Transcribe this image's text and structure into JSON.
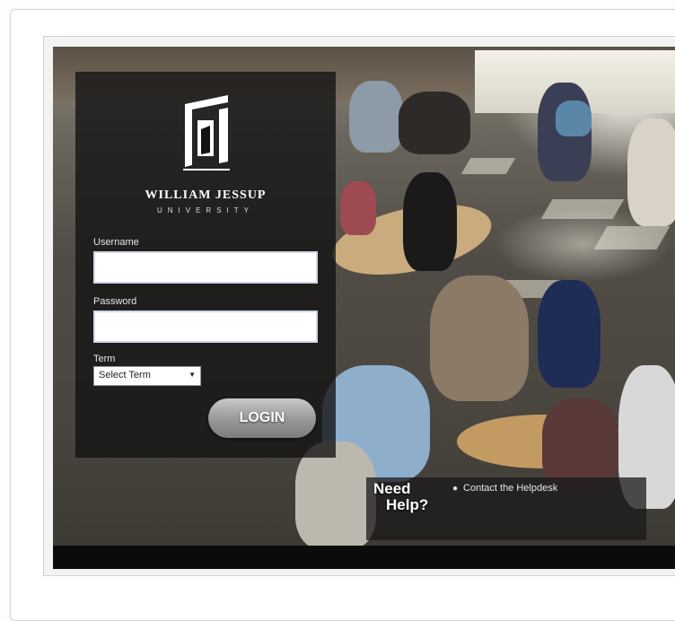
{
  "university": {
    "name": "WILLIAM JESSUP",
    "subtitle": "UNIVERSITY"
  },
  "login_form": {
    "username_label": "Username",
    "username_value": "",
    "password_label": "Password",
    "password_value": "",
    "term_label": "Term",
    "term_selected": "Select Term",
    "login_button": "LOGIN"
  },
  "help": {
    "title_line1": "Need",
    "title_line2": "Help?",
    "link": "Contact the Helpdesk"
  },
  "colors": {
    "panel": "#121212",
    "button": "#9a9a9a"
  }
}
